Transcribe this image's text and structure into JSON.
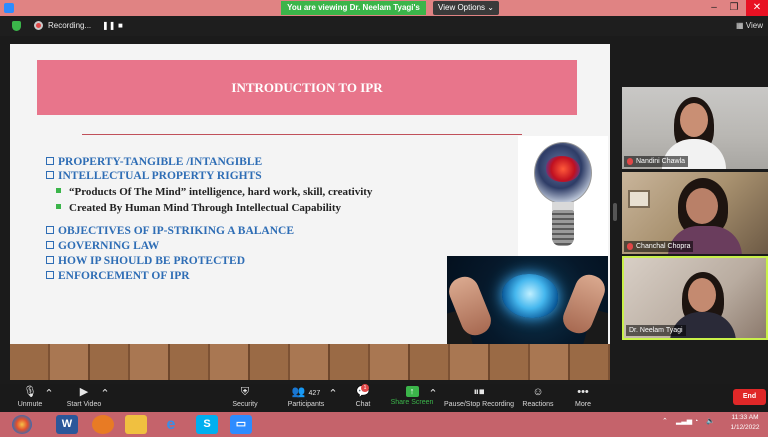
{
  "window": {
    "banner": "You are viewing Dr. Neelam Tyagi's screen",
    "view_options": "View Options",
    "view_options_caret": "⌄",
    "minimize": "–",
    "maximize": "❐",
    "close": "✕"
  },
  "recording": {
    "label": "Recording...",
    "pause": "❚❚",
    "stop": "■",
    "view_label": "▦ View"
  },
  "slide": {
    "title": "INTRODUCTION TO IPR",
    "bullets": [
      "PROPERTY-TANGIBLE /INTANGIBLE",
      "INTELLECTUAL PROPERTY RIGHTS"
    ],
    "sub_bullets": [
      "“Products Of The Mind” intelligence, hard work, skill, creativity",
      "Created By Human Mind Through Intellectual Capability"
    ],
    "bullets2": [
      "OBJECTIVES OF IP-STRIKING A BALANCE",
      "GOVERNING LAW",
      "HOW IP SHOULD BE PROTECTED",
      "ENFORCEMENT OF IPR"
    ]
  },
  "participants": [
    {
      "name": "Nandini Chawla"
    },
    {
      "name": "Chanchal Chopra"
    },
    {
      "name": "Dr. Neelam Tyagi"
    }
  ],
  "toolbar": {
    "unmute": "Unmute",
    "start_video": "Start Video",
    "security": "Security",
    "participants": "Participants",
    "participants_count": "427",
    "chat": "Chat",
    "chat_badge": "1",
    "share_screen": "Share Screen",
    "pause_recording": "Pause/Stop Recording",
    "reactions": "Reactions",
    "more": "More",
    "more_icon": "•••",
    "end": "End"
  },
  "taskbar": {
    "clock_time": "11:33 AM",
    "clock_date": "1/12/2022"
  }
}
